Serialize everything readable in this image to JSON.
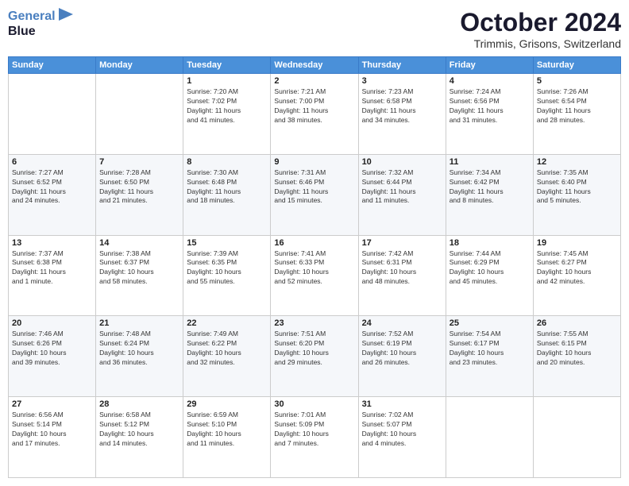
{
  "header": {
    "logo_line1": "General",
    "logo_line2": "Blue",
    "month_title": "October 2024",
    "subtitle": "Trimmis, Grisons, Switzerland"
  },
  "days_of_week": [
    "Sunday",
    "Monday",
    "Tuesday",
    "Wednesday",
    "Thursday",
    "Friday",
    "Saturday"
  ],
  "weeks": [
    [
      {
        "day": "",
        "info": ""
      },
      {
        "day": "",
        "info": ""
      },
      {
        "day": "1",
        "info": "Sunrise: 7:20 AM\nSunset: 7:02 PM\nDaylight: 11 hours\nand 41 minutes."
      },
      {
        "day": "2",
        "info": "Sunrise: 7:21 AM\nSunset: 7:00 PM\nDaylight: 11 hours\nand 38 minutes."
      },
      {
        "day": "3",
        "info": "Sunrise: 7:23 AM\nSunset: 6:58 PM\nDaylight: 11 hours\nand 34 minutes."
      },
      {
        "day": "4",
        "info": "Sunrise: 7:24 AM\nSunset: 6:56 PM\nDaylight: 11 hours\nand 31 minutes."
      },
      {
        "day": "5",
        "info": "Sunrise: 7:26 AM\nSunset: 6:54 PM\nDaylight: 11 hours\nand 28 minutes."
      }
    ],
    [
      {
        "day": "6",
        "info": "Sunrise: 7:27 AM\nSunset: 6:52 PM\nDaylight: 11 hours\nand 24 minutes."
      },
      {
        "day": "7",
        "info": "Sunrise: 7:28 AM\nSunset: 6:50 PM\nDaylight: 11 hours\nand 21 minutes."
      },
      {
        "day": "8",
        "info": "Sunrise: 7:30 AM\nSunset: 6:48 PM\nDaylight: 11 hours\nand 18 minutes."
      },
      {
        "day": "9",
        "info": "Sunrise: 7:31 AM\nSunset: 6:46 PM\nDaylight: 11 hours\nand 15 minutes."
      },
      {
        "day": "10",
        "info": "Sunrise: 7:32 AM\nSunset: 6:44 PM\nDaylight: 11 hours\nand 11 minutes."
      },
      {
        "day": "11",
        "info": "Sunrise: 7:34 AM\nSunset: 6:42 PM\nDaylight: 11 hours\nand 8 minutes."
      },
      {
        "day": "12",
        "info": "Sunrise: 7:35 AM\nSunset: 6:40 PM\nDaylight: 11 hours\nand 5 minutes."
      }
    ],
    [
      {
        "day": "13",
        "info": "Sunrise: 7:37 AM\nSunset: 6:38 PM\nDaylight: 11 hours\nand 1 minute."
      },
      {
        "day": "14",
        "info": "Sunrise: 7:38 AM\nSunset: 6:37 PM\nDaylight: 10 hours\nand 58 minutes."
      },
      {
        "day": "15",
        "info": "Sunrise: 7:39 AM\nSunset: 6:35 PM\nDaylight: 10 hours\nand 55 minutes."
      },
      {
        "day": "16",
        "info": "Sunrise: 7:41 AM\nSunset: 6:33 PM\nDaylight: 10 hours\nand 52 minutes."
      },
      {
        "day": "17",
        "info": "Sunrise: 7:42 AM\nSunset: 6:31 PM\nDaylight: 10 hours\nand 48 minutes."
      },
      {
        "day": "18",
        "info": "Sunrise: 7:44 AM\nSunset: 6:29 PM\nDaylight: 10 hours\nand 45 minutes."
      },
      {
        "day": "19",
        "info": "Sunrise: 7:45 AM\nSunset: 6:27 PM\nDaylight: 10 hours\nand 42 minutes."
      }
    ],
    [
      {
        "day": "20",
        "info": "Sunrise: 7:46 AM\nSunset: 6:26 PM\nDaylight: 10 hours\nand 39 minutes."
      },
      {
        "day": "21",
        "info": "Sunrise: 7:48 AM\nSunset: 6:24 PM\nDaylight: 10 hours\nand 36 minutes."
      },
      {
        "day": "22",
        "info": "Sunrise: 7:49 AM\nSunset: 6:22 PM\nDaylight: 10 hours\nand 32 minutes."
      },
      {
        "day": "23",
        "info": "Sunrise: 7:51 AM\nSunset: 6:20 PM\nDaylight: 10 hours\nand 29 minutes."
      },
      {
        "day": "24",
        "info": "Sunrise: 7:52 AM\nSunset: 6:19 PM\nDaylight: 10 hours\nand 26 minutes."
      },
      {
        "day": "25",
        "info": "Sunrise: 7:54 AM\nSunset: 6:17 PM\nDaylight: 10 hours\nand 23 minutes."
      },
      {
        "day": "26",
        "info": "Sunrise: 7:55 AM\nSunset: 6:15 PM\nDaylight: 10 hours\nand 20 minutes."
      }
    ],
    [
      {
        "day": "27",
        "info": "Sunrise: 6:56 AM\nSunset: 5:14 PM\nDaylight: 10 hours\nand 17 minutes."
      },
      {
        "day": "28",
        "info": "Sunrise: 6:58 AM\nSunset: 5:12 PM\nDaylight: 10 hours\nand 14 minutes."
      },
      {
        "day": "29",
        "info": "Sunrise: 6:59 AM\nSunset: 5:10 PM\nDaylight: 10 hours\nand 11 minutes."
      },
      {
        "day": "30",
        "info": "Sunrise: 7:01 AM\nSunset: 5:09 PM\nDaylight: 10 hours\nand 7 minutes."
      },
      {
        "day": "31",
        "info": "Sunrise: 7:02 AM\nSunset: 5:07 PM\nDaylight: 10 hours\nand 4 minutes."
      },
      {
        "day": "",
        "info": ""
      },
      {
        "day": "",
        "info": ""
      }
    ]
  ]
}
